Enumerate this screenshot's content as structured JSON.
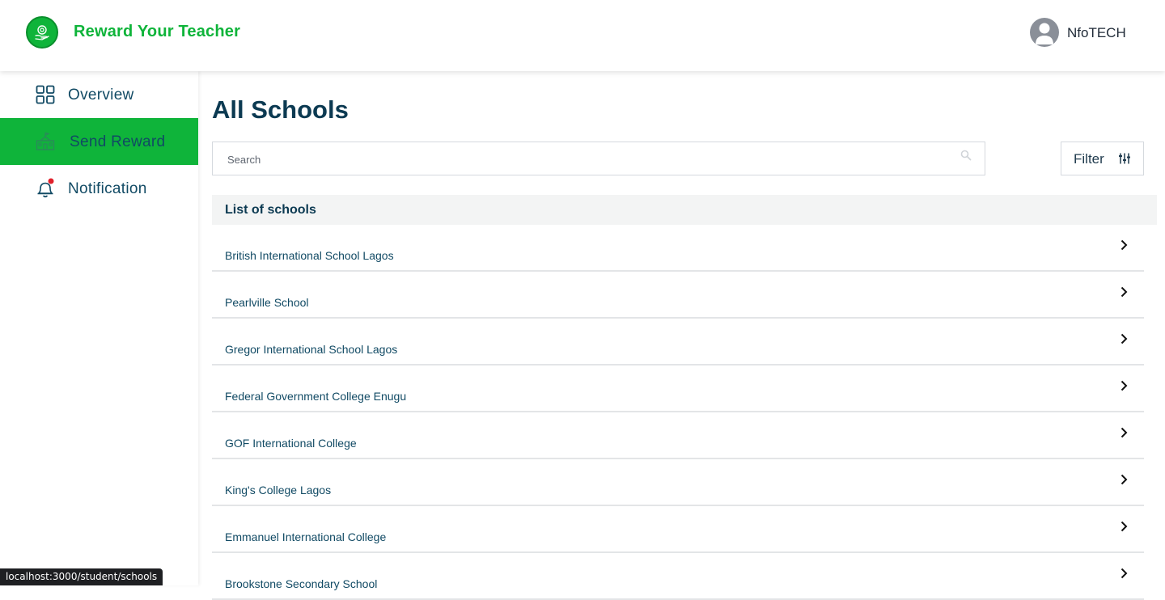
{
  "header": {
    "brand": "Reward Your Teacher",
    "username": "NfoTECH"
  },
  "sidebar": {
    "items": [
      {
        "label": "Overview",
        "icon": "grid-icon",
        "active": false
      },
      {
        "label": "Send Reward",
        "icon": "school-icon",
        "active": true
      },
      {
        "label": "Notification",
        "icon": "bell-icon",
        "active": false,
        "has_dot": true
      }
    ]
  },
  "main": {
    "title": "All Schools",
    "search": {
      "placeholder": "Search",
      "value": ""
    },
    "filter_label": "Filter",
    "list_header": "List of schools",
    "schools": [
      "British International School Lagos",
      "Pearlville School",
      "Gregor International School Lagos",
      "Federal Government College Enugu",
      "GOF International College",
      "King's College Lagos",
      "Emmanuel International College",
      "Brookstone Secondary School"
    ]
  },
  "status_bar": {
    "url": "localhost:3000/student/schools"
  },
  "colors": {
    "brand_green": "#0fb43a",
    "navy_text": "#114a64",
    "title_text": "#0c3a52",
    "notification_dot": "#e0202b"
  }
}
